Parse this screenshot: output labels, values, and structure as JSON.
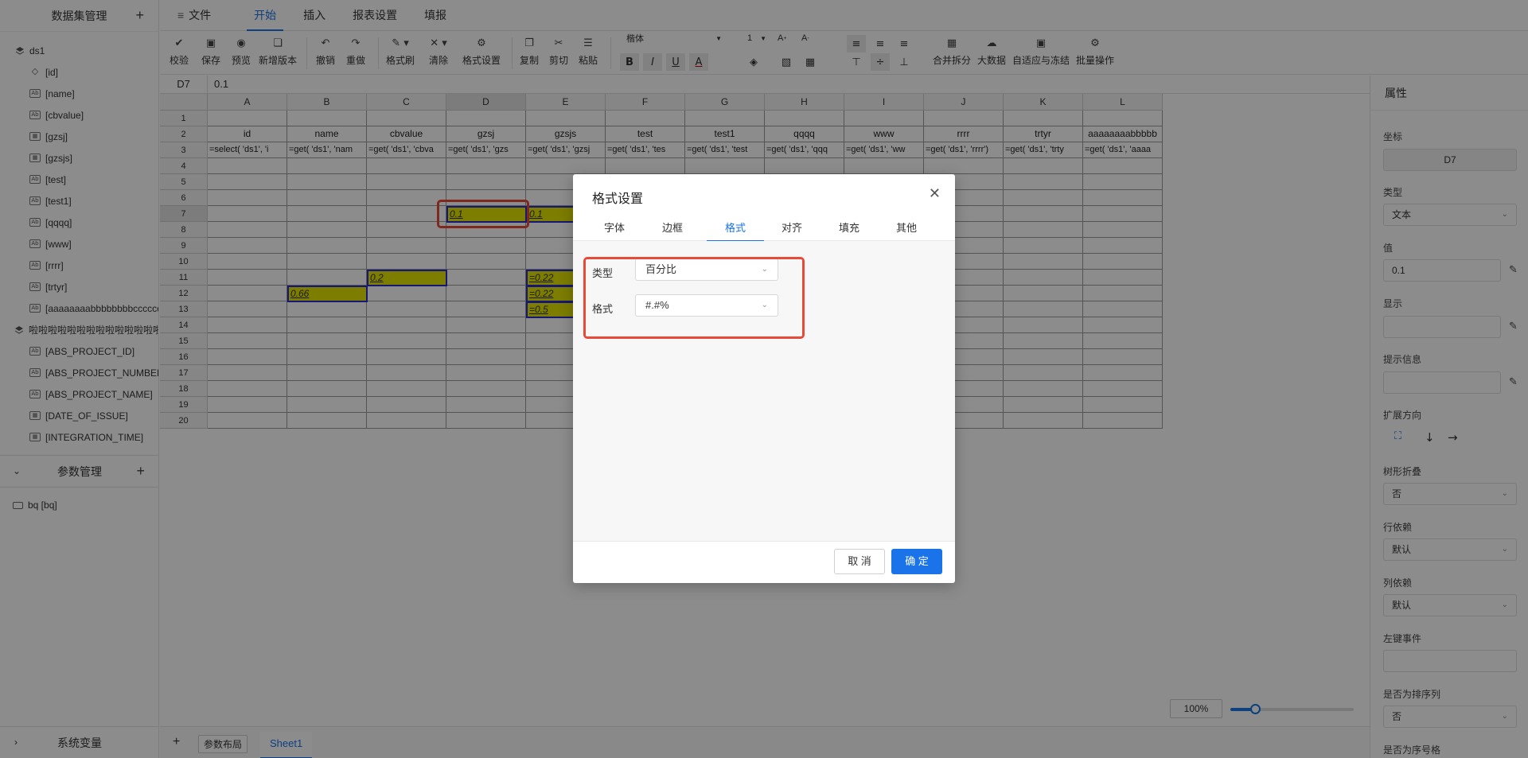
{
  "left_panel": {
    "title": "数据集管理",
    "dataset1": "ds1",
    "dataset1_fields": [
      "[id]",
      "[name]",
      "[cbvalue]",
      "[gzsj]",
      "[gzsjs]",
      "[test]",
      "[test1]",
      "[qqqq]",
      "[www]",
      "[rrrr]",
      "[trtyr]",
      "[aaaaaaaabbbbbbbbcccccccc"
    ],
    "dataset1_field_icons": [
      "tag-icon",
      "text-field-icon",
      "text-field-icon",
      "calendar-icon",
      "calendar-icon",
      "text-field-icon",
      "text-field-icon",
      "text-field-icon",
      "text-field-icon",
      "text-field-icon",
      "text-field-icon",
      "text-field-icon"
    ],
    "dataset2": "啦啦啦啦啦啦啦啦啦啦啦啦啦啦",
    "dataset2_fields": [
      "[ABS_PROJECT_ID]",
      "[ABS_PROJECT_NUMBER]",
      "[ABS_PROJECT_NAME]",
      "[DATE_OF_ISSUE]",
      "[INTEGRATION_TIME]"
    ],
    "dataset2_field_icons": [
      "text-field-icon",
      "text-field-icon",
      "text-field-icon",
      "calendar-icon",
      "calendar-icon"
    ],
    "params_title": "参数管理",
    "param_item": "bq [bq]",
    "system_vars": "系统变量"
  },
  "menu": {
    "file": "文件",
    "tabs": [
      "开始",
      "插入",
      "报表设置",
      "填报"
    ],
    "active_tab": "开始"
  },
  "toolbar": {
    "validate": "校验",
    "save": "保存",
    "preview": "预览",
    "new_version": "新增版本",
    "undo": "撤销",
    "redo": "重做",
    "format_painter": "格式刷",
    "clear": "清除",
    "format_settings": "格式设置",
    "copy": "复制",
    "cut": "剪切",
    "paste": "粘贴",
    "font_name": "楷体",
    "font_size": "1",
    "merge_split": "合并拆分",
    "big_data": "大数据",
    "auto_fit_freeze": "自适应与冻结",
    "batch_ops": "批量操作"
  },
  "formula_bar": {
    "cell_ref": "D7",
    "value": "0.1"
  },
  "grid": {
    "columns": [
      "A",
      "B",
      "C",
      "D",
      "E",
      "F",
      "G",
      "H",
      "I",
      "J",
      "K",
      "L"
    ],
    "rows": [
      "1",
      "2",
      "3",
      "4",
      "5",
      "6",
      "7",
      "8",
      "9",
      "10",
      "11",
      "12",
      "13",
      "14",
      "15",
      "16",
      "17",
      "18",
      "19",
      "20"
    ],
    "row2": [
      "id",
      "name",
      "cbvalue",
      "gzsj",
      "gzsjs",
      "test",
      "test1",
      "qqqq",
      "www",
      "rrrr",
      "trtyr",
      "aaaaaaaabbbbb"
    ],
    "row3": [
      "=select( 'ds1', 'i",
      "=get( 'ds1', 'nam",
      "=get( 'ds1', 'cbva",
      "=get( 'ds1', 'gzs",
      "=get( 'ds1', 'gzsj",
      "=get( 'ds1', 'tes",
      "=get( 'ds1', 'test",
      "=get( 'ds1', 'qqq",
      "=get( 'ds1', 'ww",
      "=get( 'ds1', 'rrrr')",
      "=get( 'ds1', 'trty",
      "=get( 'ds1', 'aaaa"
    ],
    "d7": "0.1",
    "e7": "0.1",
    "c11": "0.2",
    "b12": "0.66",
    "e11": "=0.22",
    "e12": "=0.22",
    "e13": "=0.5"
  },
  "bottom_bar": {
    "add": "+",
    "param_layout": "参数布局",
    "sheet": "Sheet1",
    "zoom": "100%",
    "zoom_level": 0.2
  },
  "properties": {
    "title": "属性",
    "coord_label": "坐标",
    "coord_value": "D7",
    "type_label": "类型",
    "type_value": "文本",
    "value_label": "值",
    "value_value": "0.1",
    "display_label": "显示",
    "tooltip_label": "提示信息",
    "expand_label": "扩展方向",
    "tree_fold_label": "树形折叠",
    "tree_fold_value": "否",
    "row_dep_label": "行依赖",
    "row_dep_value": "默认",
    "col_dep_label": "列依赖",
    "col_dep_value": "默认",
    "left_click_label": "左键事件",
    "sort_col_label": "是否为排序列",
    "sort_col_value": "否",
    "seq_col_label": "是否为序号格"
  },
  "modal": {
    "title": "格式设置",
    "tabs": [
      "字体",
      "边框",
      "格式",
      "对齐",
      "填充",
      "其他"
    ],
    "active_tab": "格式",
    "type_label": "类型",
    "type_value": "百分比",
    "format_label": "格式",
    "format_value": "#.#%",
    "cancel": "取 消",
    "ok": "确 定"
  },
  "colors": {
    "accent": "#1a73e8",
    "highlight_box": "#e84a3a",
    "cell_fill": "#e4e400",
    "cell_border": "#2b2bd6"
  }
}
